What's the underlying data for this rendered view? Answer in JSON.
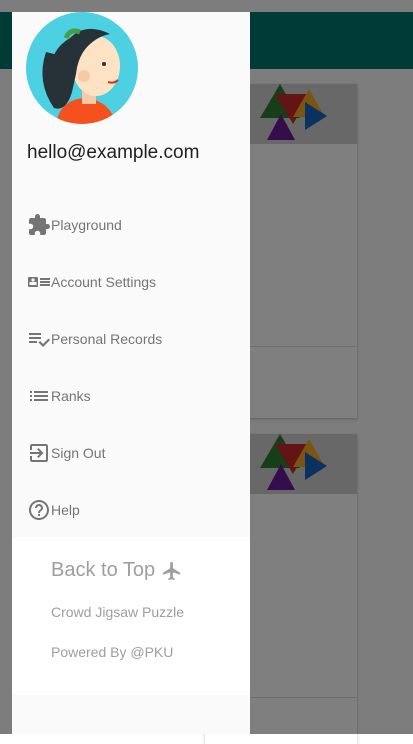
{
  "user": {
    "email": "hello@example.com"
  },
  "menu": {
    "items": [
      {
        "label": "Playground",
        "icon": "puzzle-icon"
      },
      {
        "label": "Account Settings",
        "icon": "account-card-icon"
      },
      {
        "label": "Personal Records",
        "icon": "playlist-check-icon"
      },
      {
        "label": "Ranks",
        "icon": "list-icon"
      },
      {
        "label": "Sign Out",
        "icon": "sign-out-icon"
      },
      {
        "label": "Help",
        "icon": "help-circle-icon"
      }
    ]
  },
  "footer": {
    "back_to_top": "Back to Top",
    "title": "Crowd Jigsaw Puzzle",
    "powered_by": "Powered By @PKU"
  },
  "colors": {
    "header": "#00796b",
    "menu_text": "#757575",
    "footer_text": "#9e9e9e",
    "avatar_bg": "#4dd0e1"
  }
}
